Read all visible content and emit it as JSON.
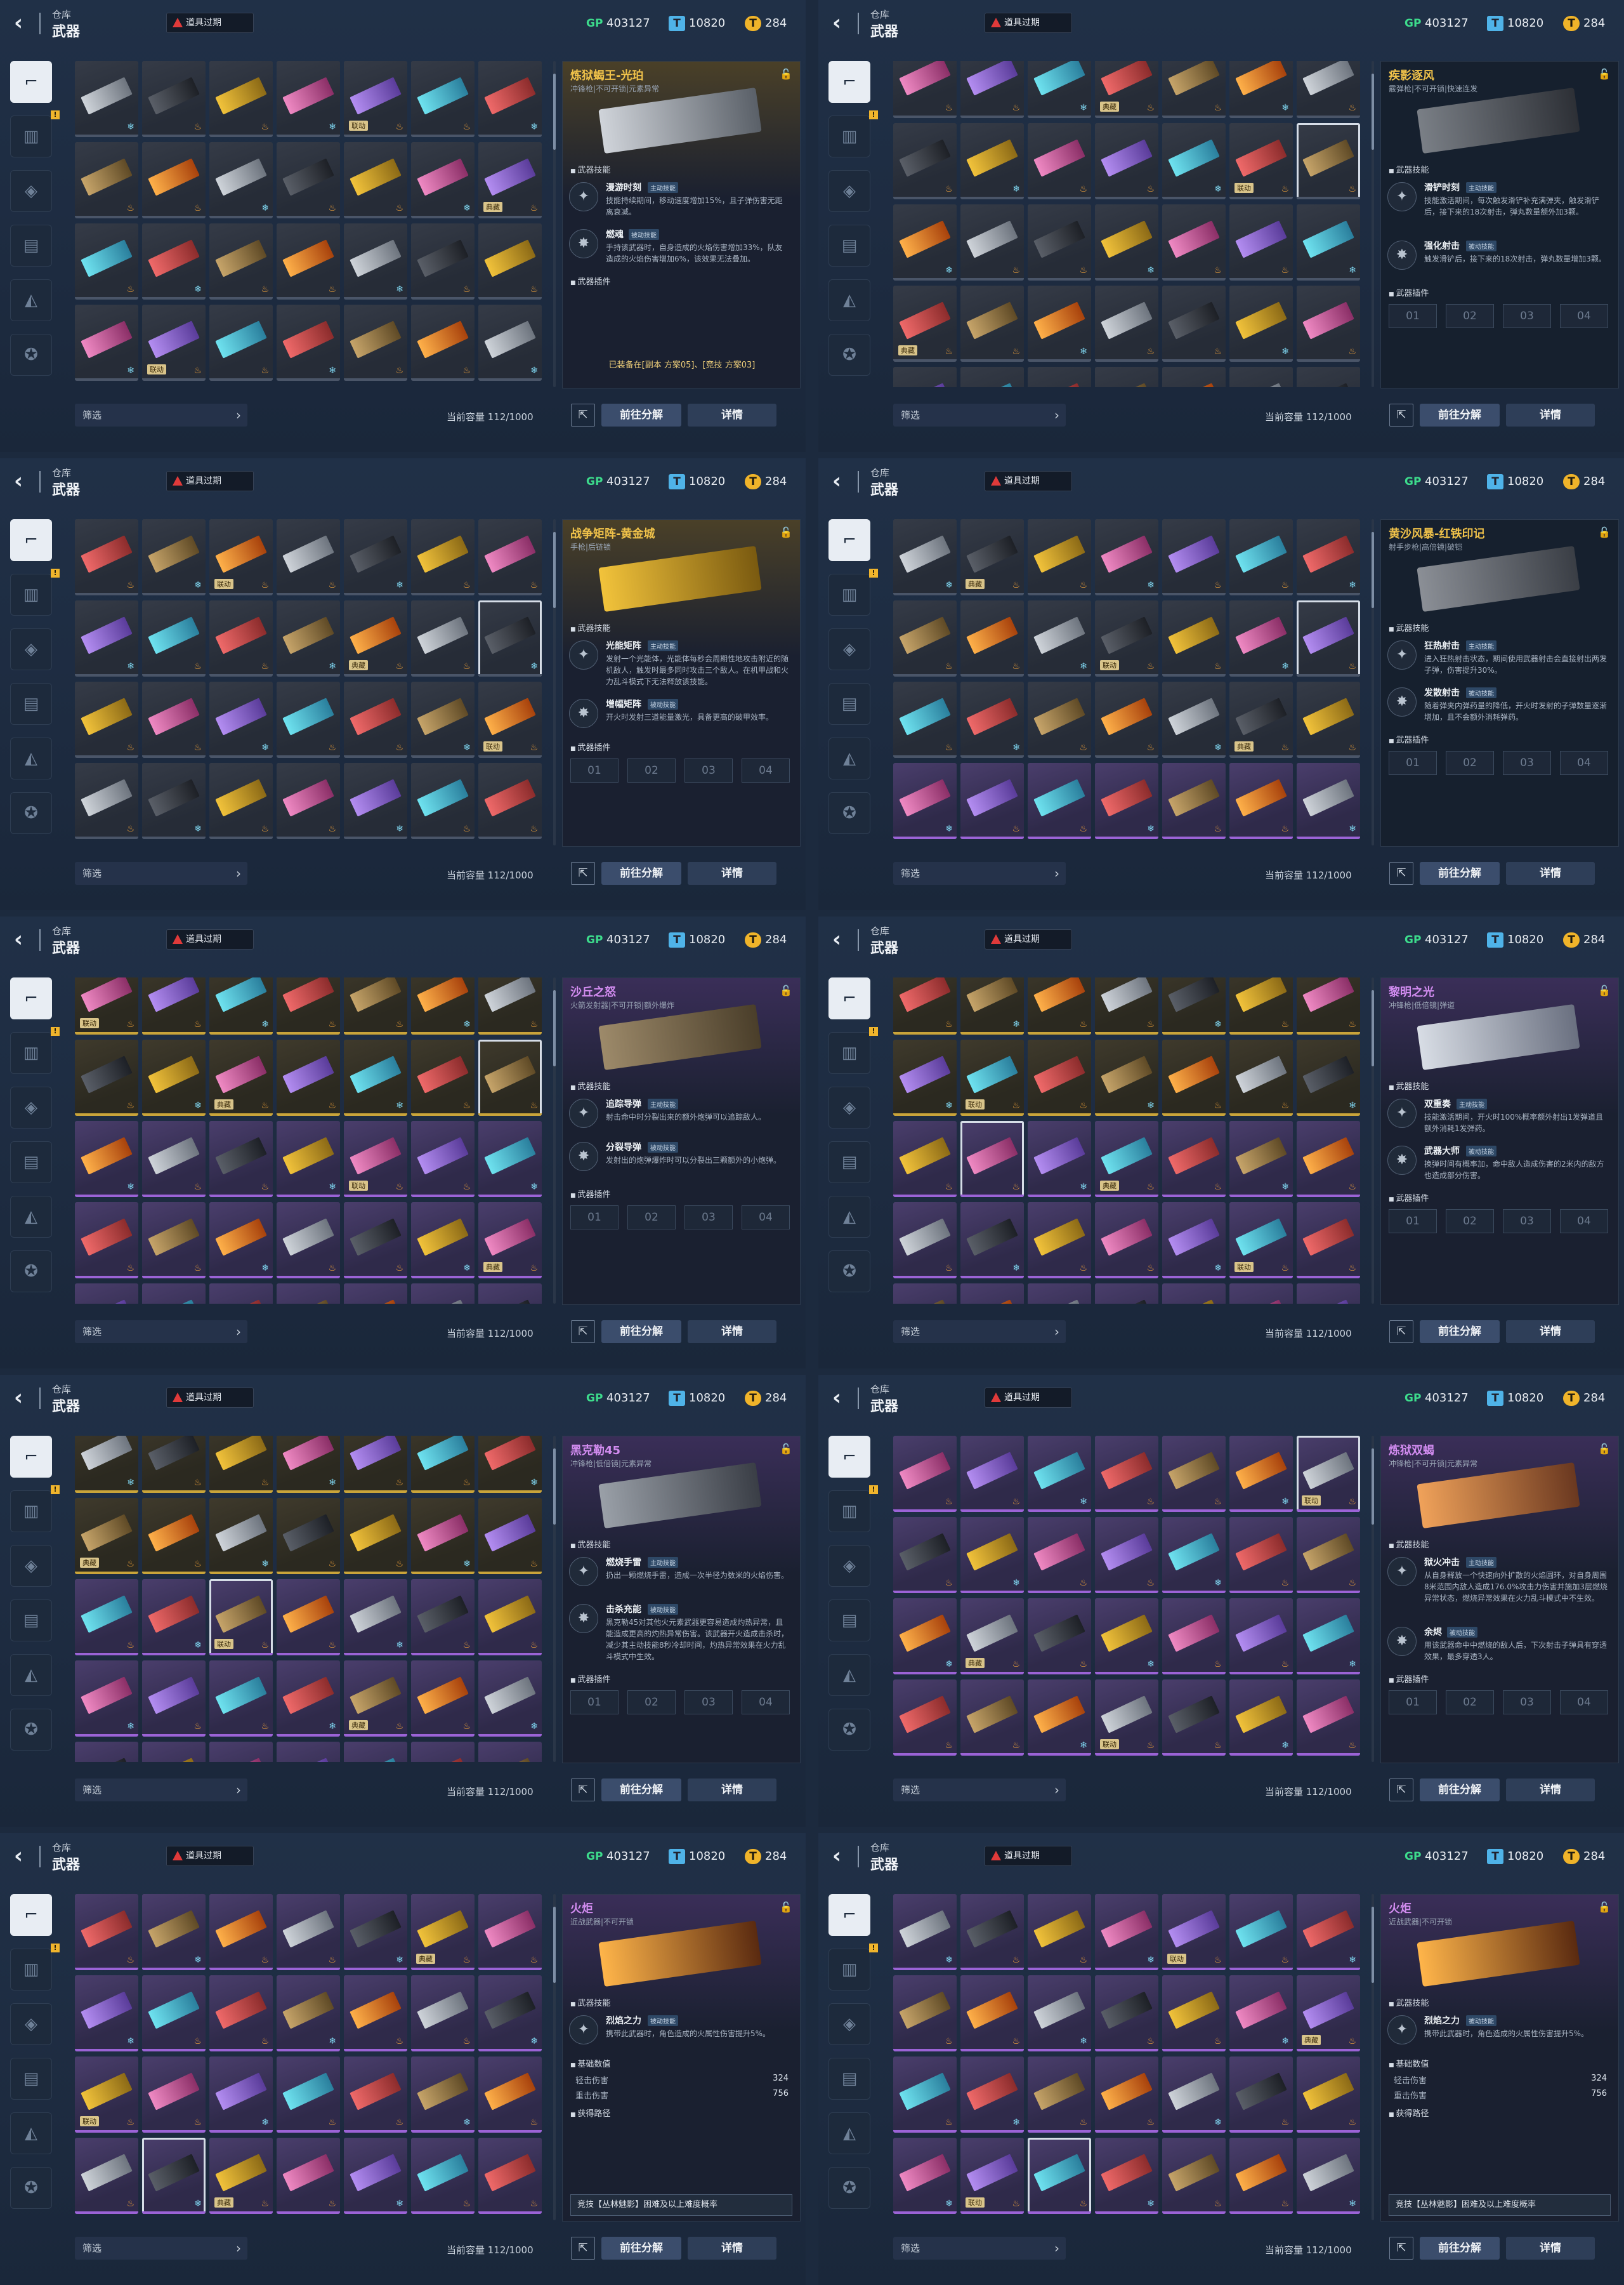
{
  "common": {
    "breadcrumb": "仓库",
    "title": "武器",
    "expired_label": "道具过期",
    "currencies": [
      {
        "icon": "gp-currency-icon",
        "symbol": "GP",
        "value": "403127"
      },
      {
        "icon": "ticket-currency-icon",
        "symbol": "T",
        "value": "10820"
      },
      {
        "icon": "coin-currency-icon",
        "symbol": "T",
        "value": "284"
      }
    ],
    "filter_label": "筛选",
    "capacity": "当前容量 112/1000",
    "decompose_label": "前往分解",
    "details_label": "详情",
    "skills_header": "武器技能",
    "plugins_header": "武器插件",
    "base_stats_header": "基础数值",
    "source_header": "获得路径",
    "active_badge": "主动技能",
    "passive_badge": "被动技能",
    "slot_labels": [
      "01",
      "02",
      "03",
      "04"
    ],
    "sidebar_icons": [
      "pistol-icon",
      "ammo-icon",
      "grenade-icon",
      "vehicle-icon",
      "rank-icon",
      "settings-star-icon"
    ]
  },
  "panels": [
    {
      "name": "炼狱蝎王-光珀",
      "type": "冲锋枪|不可开锁|元素异常",
      "skills": [
        {
          "name": "漫游时刻",
          "badge": "主动技能",
          "desc": "技能持续期间，移动速度增加15%，且子弹伤害无距离衰减。"
        },
        {
          "name": "燃魂",
          "badge": "被动技能",
          "desc": "手持该武器时，自身造成的火焰伤害增加33%，队友造成的火焰伤害增加6%，该效果无法叠加。"
        }
      ],
      "equip_note": "已装备在[副本 方案05]、[竞技 方案03]"
    },
    {
      "name": "疾影逐风",
      "type": "霰弹枪|不可开锁|快速连发",
      "skills": [
        {
          "name": "滑铲时刻",
          "badge": "主动技能",
          "desc": "技能激活期间，每次触发滑铲补充满弹夹，触发滑铲后，接下来的18次射击，弹丸数量额外加3颗。"
        },
        {
          "name": "强化射击",
          "badge": "被动技能",
          "desc": "触发滑铲后，接下来的18次射击，弹丸数量增加3颗。"
        }
      ]
    },
    {
      "name": "战争矩阵-黄金城",
      "type": "手枪|后链锁",
      "skills": [
        {
          "name": "光能矩阵",
          "badge": "主动技能",
          "desc": "发射一个光能体，光能体每秒会周期性地攻击附近的随机敌人，触发时最多同时攻击三个敌人。在机甲战和火力乱斗模式下无法释放该技能。"
        },
        {
          "name": "增幅矩阵",
          "badge": "被动技能",
          "desc": "开火时发射三道能量激光，具备更高的破甲效率。"
        }
      ]
    },
    {
      "name": "黄沙风暴-红铁印记",
      "type": "射手步枪|高倍镜|破铠",
      "skills": [
        {
          "name": "狂热射击",
          "badge": "主动技能",
          "desc": "进入狂热射击状态，期间使用武器射击会直接射出两发子弹，伤害提升30%。"
        },
        {
          "name": "发散射击",
          "badge": "被动技能",
          "desc": "随着弹夹内弹药量的降低，开火时发射的子弹数量逐渐增加，且不会额外消耗弹药。"
        }
      ]
    },
    {
      "name": "沙丘之怒",
      "type": "火箭发射器|不可开锁|额外爆炸",
      "skills": [
        {
          "name": "追踪导弹",
          "badge": "主动技能",
          "desc": "射击命中时分裂出来的额外炮弹可以追踪敌人。"
        },
        {
          "name": "分裂导弹",
          "badge": "被动技能",
          "desc": "发射出的炮弹爆炸时可以分裂出三颗额外的小炮弹。"
        }
      ]
    },
    {
      "name": "黎明之光",
      "type": "冲锋枪|低倍镜|弹道",
      "skills": [
        {
          "name": "双重奏",
          "badge": "主动技能",
          "desc": "技能激活期间，开火时100%概率额外射出1发弹道且额外消耗1发弹药。"
        },
        {
          "name": "武器大师",
          "badge": "被动技能",
          "desc": "换弹时间有概率加，命中敌人造成伤害的2米内的敌方也造成部分伤害。"
        }
      ]
    },
    {
      "name": "黑克勒45",
      "type": "冲锋枪|低倍镜|元素异常",
      "skills": [
        {
          "name": "燃烧手雷",
          "badge": "主动技能",
          "desc": "扔出一颗燃烧手雷，造成一次半径为数米的火焰伤害。"
        },
        {
          "name": "击杀充能",
          "badge": "被动技能",
          "desc": "黑克勒45对其他火元素武器更容易造成灼热异常，且能造成更高的灼热异常伤害。该武器开火造成击杀时，减少其主动技能8秒冷却时间，灼热异常效果在火力乱斗模式中生效。"
        }
      ]
    },
    {
      "name": "炼狱双蝎",
      "type": "冲锋枪|不可开锁|元素异常",
      "skills": [
        {
          "name": "狱火冲击",
          "badge": "主动技能",
          "desc": "从自身释放一个快速向外扩散的火焰圆环，对自身周围8米范围内敌人造成176.0%攻击力伤害并施加3层燃烧异常状态，燃烧异常效果在火力乱斗模式中不生效。"
        },
        {
          "name": "余烬",
          "badge": "被动技能",
          "desc": "用该武器命中中燃烧的敌人后，下次射击子弹具有穿透效果，最多穿透3人。"
        }
      ]
    },
    {
      "name": "火炬",
      "type": "近战武器|不可开锁",
      "skills": [
        {
          "name": "烈焰之力",
          "badge": "被动技能",
          "desc": "携带此武器时，角色造成的火属性伤害提升5%。"
        }
      ],
      "stats": [
        {
          "label": "轻击伤害",
          "value": "324"
        },
        {
          "label": "重击伤害",
          "value": "756"
        }
      ],
      "route": "竞技【丛林魅影】困难及以上难度概率"
    },
    {
      "name": "火炬",
      "type": "近战武器|不可开锁",
      "skills": [
        {
          "name": "烈焰之力",
          "badge": "被动技能",
          "desc": "携带此武器时，角色造成的火属性伤害提升5%。"
        }
      ],
      "stats": [
        {
          "label": "轻击伤害",
          "value": "324"
        },
        {
          "label": "重击伤害",
          "value": "756"
        }
      ],
      "route": "竞技【丛林魅影】困难及以上难度概率"
    }
  ],
  "card_tags": [
    "联动",
    "典藏"
  ]
}
